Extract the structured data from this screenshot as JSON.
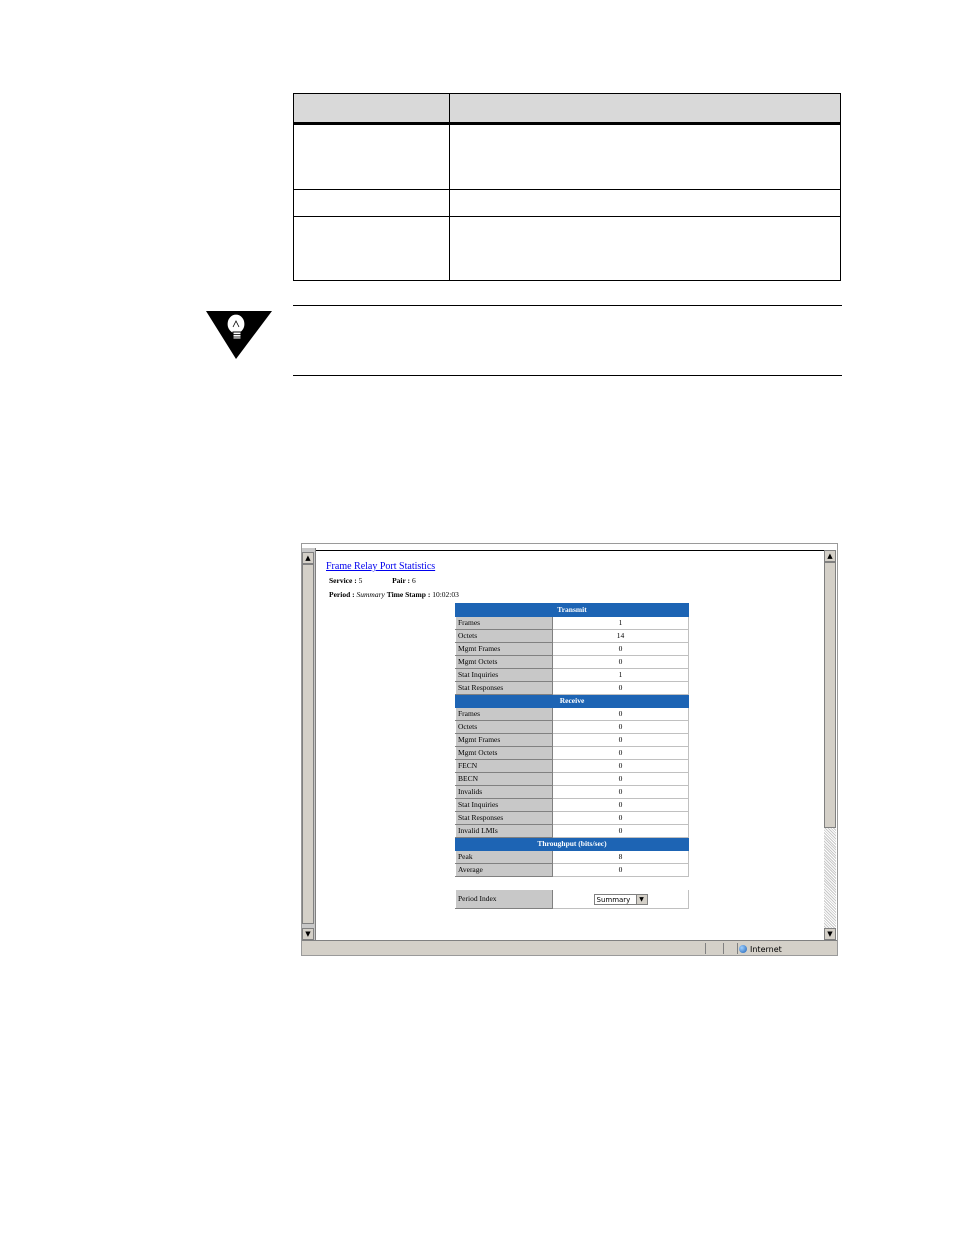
{
  "stats_page": {
    "title": "Frame Relay Port Statistics",
    "service_label": "Service :",
    "service_value": "5",
    "pair_label": "Pair :",
    "pair_value": "6",
    "period_label": "Period :",
    "period_value": "Summary",
    "timestamp_label": "Time Stamp :",
    "timestamp_value": "10:02:03",
    "transmit": {
      "header": "Transmit",
      "rows": [
        {
          "label": "Frames",
          "value": "1"
        },
        {
          "label": "Octets",
          "value": "14"
        },
        {
          "label": "Mgmt Frames",
          "value": "0"
        },
        {
          "label": "Mgmt Octets",
          "value": "0"
        },
        {
          "label": "Stat Inquiries",
          "value": "1"
        },
        {
          "label": "Stat Responses",
          "value": "0"
        }
      ]
    },
    "receive": {
      "header": "Receive",
      "rows": [
        {
          "label": "Frames",
          "value": "0"
        },
        {
          "label": "Octets",
          "value": "0"
        },
        {
          "label": "Mgmt Frames",
          "value": "0"
        },
        {
          "label": "Mgmt Octets",
          "value": "0"
        },
        {
          "label": "FECN",
          "value": "0"
        },
        {
          "label": "BECN",
          "value": "0"
        },
        {
          "label": "Invalids",
          "value": "0"
        },
        {
          "label": "Stat Inquiries",
          "value": "0"
        },
        {
          "label": "Stat Responses",
          "value": "0"
        },
        {
          "label": "Invalid LMIs",
          "value": "0"
        }
      ]
    },
    "throughput": {
      "header": "Throughput (bits/sec)",
      "rows": [
        {
          "label": "Peak",
          "value": "8"
        },
        {
          "label": "Average",
          "value": "0"
        }
      ]
    },
    "period_index": {
      "label": "Period Index",
      "selected": "Summary"
    }
  },
  "browser": {
    "status_zone": "Internet",
    "scroll_up_glyph": "▲",
    "scroll_down_glyph": "▼",
    "select_arrow_glyph": "▼"
  }
}
